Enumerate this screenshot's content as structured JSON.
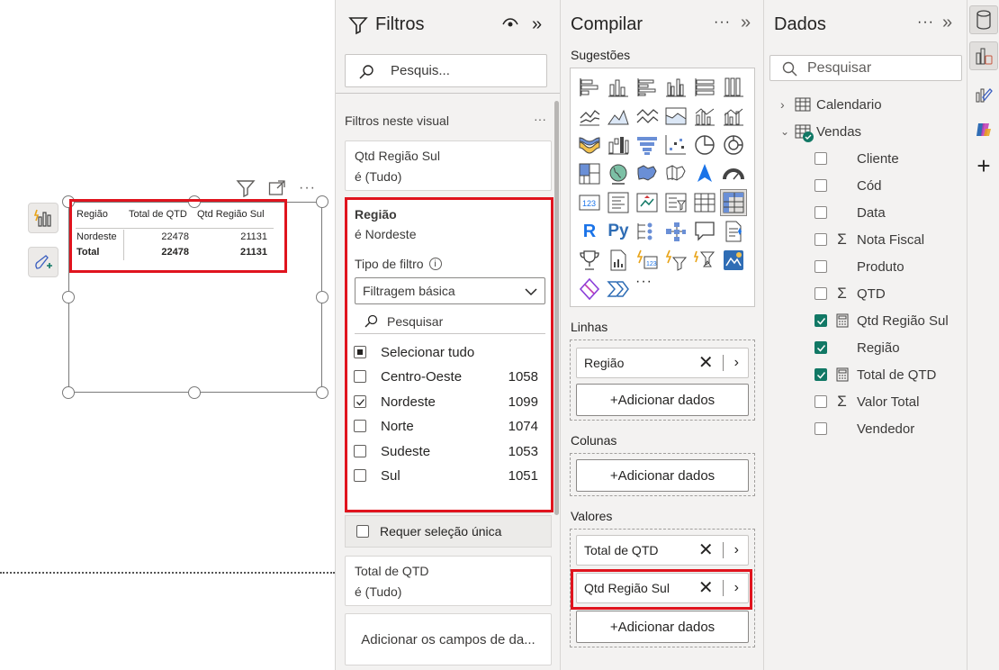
{
  "canvas": {
    "table": {
      "headers": [
        "Região",
        "Total de QTD",
        "Qtd Região Sul"
      ],
      "rows": [
        [
          "Nordeste",
          "22478",
          "21131"
        ]
      ],
      "total": [
        "Total",
        "22478",
        "21131"
      ]
    },
    "header_icons": [
      "filter-icon",
      "focus-mode-icon",
      "more-options-icon"
    ]
  },
  "filters": {
    "title": "Filtros",
    "search_placeholder": "Pesquis...",
    "section_label": "Filtros neste visual",
    "cards": [
      {
        "title": "Qtd Região Sul",
        "subtitle": "é (Tudo)"
      },
      {
        "title": "Total de QTD",
        "subtitle": "é (Tudo)"
      }
    ],
    "region_card": {
      "title": "Região",
      "subtitle": "é Nordeste",
      "filter_type_label": "Tipo de filtro",
      "filter_type_value": "Filtragem básica",
      "search_placeholder": "Pesquisar",
      "select_all": "Selecionar tudo",
      "options": [
        {
          "label": "Centro-Oeste",
          "count": "1058",
          "checked": false
        },
        {
          "label": "Nordeste",
          "count": "1099",
          "checked": true
        },
        {
          "label": "Norte",
          "count": "1074",
          "checked": false
        },
        {
          "label": "Sudeste",
          "count": "1053",
          "checked": false
        },
        {
          "label": "Sul",
          "count": "1051",
          "checked": false
        }
      ]
    },
    "single_select_label": "Requer seleção única",
    "add_fields_label": "Adicionar os campos de da..."
  },
  "build": {
    "title": "Compilar",
    "suggestions_label": "Sugestões",
    "rows_label": "Linhas",
    "rows_fields": [
      "Região"
    ],
    "columns_label": "Colunas",
    "values_label": "Valores",
    "values_fields": [
      "Total de QTD",
      "Qtd Região Sul"
    ],
    "add_data_label": "+Adicionar dados",
    "more_visuals": "···"
  },
  "data": {
    "title": "Dados",
    "search_placeholder": "Pesquisar",
    "tables": [
      {
        "name": "Calendario",
        "expanded": false
      },
      {
        "name": "Vendas",
        "expanded": true
      }
    ],
    "fields": [
      {
        "name": "Cliente",
        "checked": false,
        "icon": ""
      },
      {
        "name": "Cód",
        "checked": false,
        "icon": ""
      },
      {
        "name": "Data",
        "checked": false,
        "icon": ""
      },
      {
        "name": "Nota Fiscal",
        "checked": false,
        "icon": "sigma"
      },
      {
        "name": "Produto",
        "checked": false,
        "icon": ""
      },
      {
        "name": "QTD",
        "checked": false,
        "icon": "sigma"
      },
      {
        "name": "Qtd Região Sul",
        "checked": true,
        "icon": "calculator"
      },
      {
        "name": "Região",
        "checked": true,
        "icon": ""
      },
      {
        "name": "Total de QTD",
        "checked": true,
        "icon": "calculator"
      },
      {
        "name": "Valor Total",
        "checked": false,
        "icon": "sigma"
      },
      {
        "name": "Vendedor",
        "checked": false,
        "icon": ""
      }
    ]
  },
  "colors": {
    "accent_red": "#e0141e",
    "check_green": "#117865",
    "pane_bg": "#f3f2f1"
  }
}
